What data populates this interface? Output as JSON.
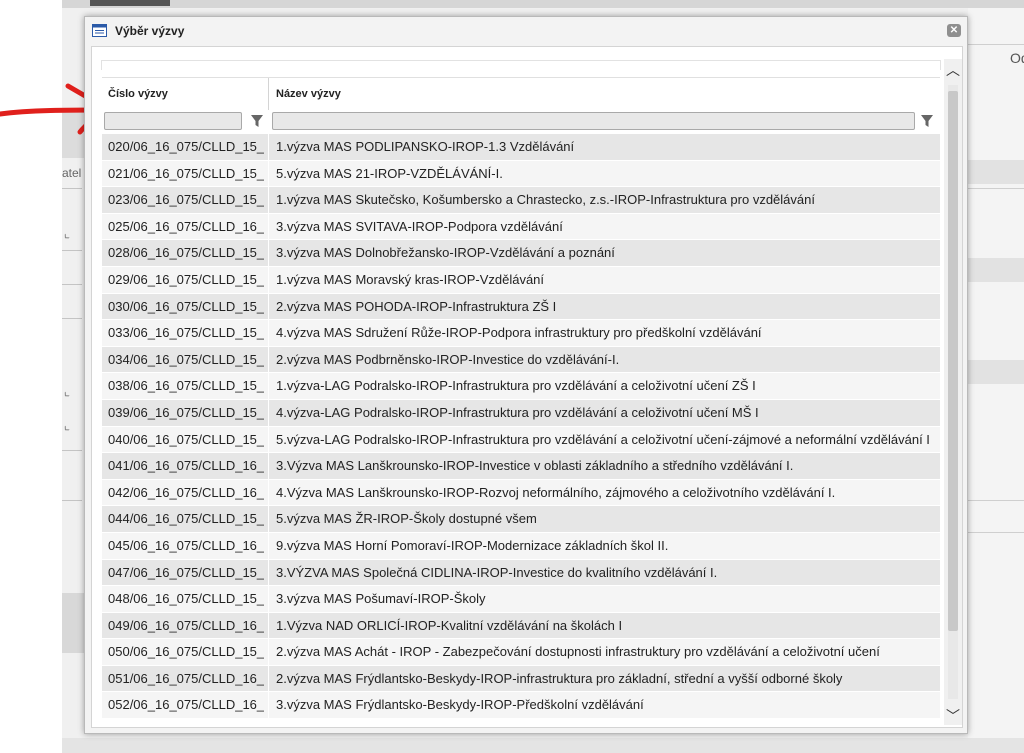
{
  "background": {
    "left_label": "atel",
    "right_label": "Od"
  },
  "dialog": {
    "title": "Výběr výzvy",
    "close_symbol": "✕",
    "columns": {
      "number_header": "Číslo výzvy",
      "name_header": "Název výzvy"
    },
    "filters": {
      "number_value": "",
      "name_value": ""
    },
    "rows": [
      {
        "number": "020/06_16_075/CLLD_15_...",
        "name": "1.výzva MAS PODLIPANSKO-IROP-1.3 Vzdělávání"
      },
      {
        "number": "021/06_16_075/CLLD_15_...",
        "name": "5.výzva MAS 21-IROP-VZDĚLÁVÁNÍ-I."
      },
      {
        "number": "023/06_16_075/CLLD_15_...",
        "name": "1.výzva MAS Skutečsko, Košumbersko a Chrastecko, z.s.-IROP-Infrastruktura pro vzdělávání"
      },
      {
        "number": "025/06_16_075/CLLD_16_...",
        "name": "3.výzva MAS SVITAVA-IROP-Podpora vzdělávání"
      },
      {
        "number": "028/06_16_075/CLLD_15_...",
        "name": "3.výzva MAS Dolnobřežansko-IROP-Vzdělávání a poznání"
      },
      {
        "number": "029/06_16_075/CLLD_15_...",
        "name": "1.výzva MAS Moravský kras-IROP-Vzdělávání"
      },
      {
        "number": "030/06_16_075/CLLD_15_...",
        "name": "2.výzva MAS POHODA-IROP-Infrastruktura ZŠ I"
      },
      {
        "number": "033/06_16_075/CLLD_15_...",
        "name": "4.výzva MAS Sdružení Růže-IROP-Podpora infrastruktury pro předškolní vzdělávání"
      },
      {
        "number": "034/06_16_075/CLLD_15_...",
        "name": "2.výzva MAS Podbrněnsko-IROP-Investice do vzdělávání-I."
      },
      {
        "number": "038/06_16_075/CLLD_15_...",
        "name": "1.výzva-LAG Podralsko-IROP-Infrastruktura pro vzdělávání a celoživotní učení ZŠ I"
      },
      {
        "number": "039/06_16_075/CLLD_15_...",
        "name": "4.výzva-LAG Podralsko-IROP-Infrastruktura pro vzdělávání a celoživotní učení MŠ I"
      },
      {
        "number": "040/06_16_075/CLLD_15_...",
        "name": "5.výzva-LAG Podralsko-IROP-Infrastruktura pro vzdělávání a celoživotní učení-zájmové a neformální vzdělávání I"
      },
      {
        "number": "041/06_16_075/CLLD_16_...",
        "name": "3.Výzva MAS Lanškrounsko-IROP-Investice v oblasti základního a středního vzdělávání I."
      },
      {
        "number": "042/06_16_075/CLLD_16_...",
        "name": "4.Výzva MAS Lanškrounsko-IROP-Rozvoj neformálního, zájmového a celoživotního vzdělávání I."
      },
      {
        "number": "044/06_16_075/CLLD_15_...",
        "name": "5.výzva MAS ŽR-IROP-Školy dostupné všem"
      },
      {
        "number": "045/06_16_075/CLLD_16_...",
        "name": "9.výzva MAS Horní Pomoraví-IROP-Modernizace základních škol II."
      },
      {
        "number": "047/06_16_075/CLLD_15_...",
        "name": "3.VÝZVA MAS Společná CIDLINA-IROP-Investice do kvalitního vzdělávání I."
      },
      {
        "number": "048/06_16_075/CLLD_15_...",
        "name": "3.výzva MAS Pošumaví-IROP-Školy"
      },
      {
        "number": "049/06_16_075/CLLD_16_...",
        "name": "1.Výzva NAD ORLICÍ-IROP-Kvalitní vzdělávání na školách I"
      },
      {
        "number": "050/06_16_075/CLLD_15_...",
        "name": "2.výzva MAS Achát - IROP - Zabezpečování dostupnosti infrastruktury pro vzdělávání a celoživotní učení"
      },
      {
        "number": "051/06_16_075/CLLD_16_...",
        "name": "2.výzva MAS Frýdlantsko-Beskydy-IROP-infrastruktura pro základní, střední a vyšší odborné školy"
      },
      {
        "number": "052/06_16_075/CLLD_16_...",
        "name": "3.výzva MAS Frýdlantsko-Beskydy-IROP-Předškolní vzdělávání"
      }
    ]
  },
  "colors": {
    "annotation_red": "#e0201c",
    "row_odd": "#e6e6e6",
    "row_even": "#f5f5f5"
  },
  "icons": [
    "window-icon",
    "close-icon",
    "filter-funnel-icon",
    "scroll-up-icon",
    "scroll-down-icon",
    "red-arrow-annotation"
  ]
}
